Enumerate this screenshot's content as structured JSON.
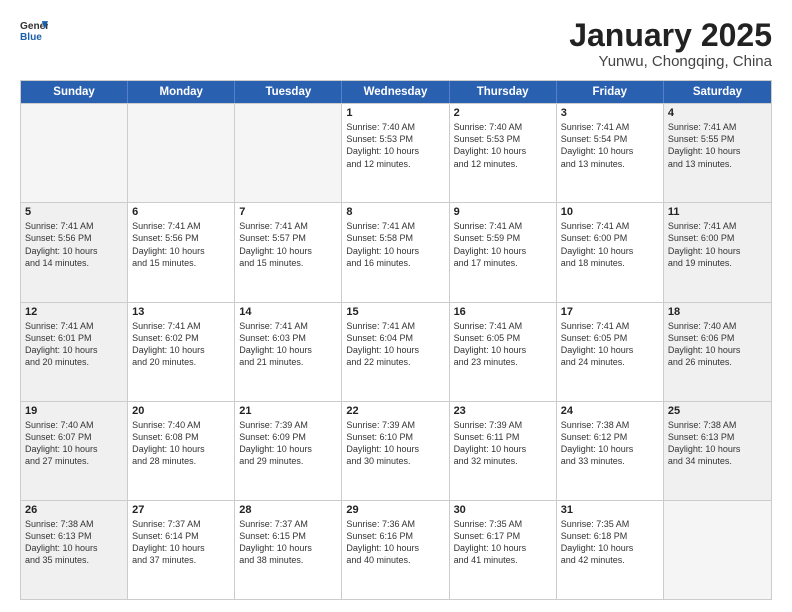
{
  "header": {
    "logo_general": "General",
    "logo_blue": "Blue",
    "month_title": "January 2025",
    "location": "Yunwu, Chongqing, China"
  },
  "days_of_week": [
    "Sunday",
    "Monday",
    "Tuesday",
    "Wednesday",
    "Thursday",
    "Friday",
    "Saturday"
  ],
  "rows": [
    [
      {
        "day": "",
        "info": "",
        "empty": true
      },
      {
        "day": "",
        "info": "",
        "empty": true
      },
      {
        "day": "",
        "info": "",
        "empty": true
      },
      {
        "day": "1",
        "info": "Sunrise: 7:40 AM\nSunset: 5:53 PM\nDaylight: 10 hours\nand 12 minutes."
      },
      {
        "day": "2",
        "info": "Sunrise: 7:40 AM\nSunset: 5:53 PM\nDaylight: 10 hours\nand 12 minutes."
      },
      {
        "day": "3",
        "info": "Sunrise: 7:41 AM\nSunset: 5:54 PM\nDaylight: 10 hours\nand 13 minutes."
      },
      {
        "day": "4",
        "info": "Sunrise: 7:41 AM\nSunset: 5:55 PM\nDaylight: 10 hours\nand 13 minutes."
      }
    ],
    [
      {
        "day": "5",
        "info": "Sunrise: 7:41 AM\nSunset: 5:56 PM\nDaylight: 10 hours\nand 14 minutes."
      },
      {
        "day": "6",
        "info": "Sunrise: 7:41 AM\nSunset: 5:56 PM\nDaylight: 10 hours\nand 15 minutes."
      },
      {
        "day": "7",
        "info": "Sunrise: 7:41 AM\nSunset: 5:57 PM\nDaylight: 10 hours\nand 15 minutes."
      },
      {
        "day": "8",
        "info": "Sunrise: 7:41 AM\nSunset: 5:58 PM\nDaylight: 10 hours\nand 16 minutes."
      },
      {
        "day": "9",
        "info": "Sunrise: 7:41 AM\nSunset: 5:59 PM\nDaylight: 10 hours\nand 17 minutes."
      },
      {
        "day": "10",
        "info": "Sunrise: 7:41 AM\nSunset: 6:00 PM\nDaylight: 10 hours\nand 18 minutes."
      },
      {
        "day": "11",
        "info": "Sunrise: 7:41 AM\nSunset: 6:00 PM\nDaylight: 10 hours\nand 19 minutes."
      }
    ],
    [
      {
        "day": "12",
        "info": "Sunrise: 7:41 AM\nSunset: 6:01 PM\nDaylight: 10 hours\nand 20 minutes."
      },
      {
        "day": "13",
        "info": "Sunrise: 7:41 AM\nSunset: 6:02 PM\nDaylight: 10 hours\nand 20 minutes."
      },
      {
        "day": "14",
        "info": "Sunrise: 7:41 AM\nSunset: 6:03 PM\nDaylight: 10 hours\nand 21 minutes."
      },
      {
        "day": "15",
        "info": "Sunrise: 7:41 AM\nSunset: 6:04 PM\nDaylight: 10 hours\nand 22 minutes."
      },
      {
        "day": "16",
        "info": "Sunrise: 7:41 AM\nSunset: 6:05 PM\nDaylight: 10 hours\nand 23 minutes."
      },
      {
        "day": "17",
        "info": "Sunrise: 7:41 AM\nSunset: 6:05 PM\nDaylight: 10 hours\nand 24 minutes."
      },
      {
        "day": "18",
        "info": "Sunrise: 7:40 AM\nSunset: 6:06 PM\nDaylight: 10 hours\nand 26 minutes."
      }
    ],
    [
      {
        "day": "19",
        "info": "Sunrise: 7:40 AM\nSunset: 6:07 PM\nDaylight: 10 hours\nand 27 minutes."
      },
      {
        "day": "20",
        "info": "Sunrise: 7:40 AM\nSunset: 6:08 PM\nDaylight: 10 hours\nand 28 minutes."
      },
      {
        "day": "21",
        "info": "Sunrise: 7:39 AM\nSunset: 6:09 PM\nDaylight: 10 hours\nand 29 minutes."
      },
      {
        "day": "22",
        "info": "Sunrise: 7:39 AM\nSunset: 6:10 PM\nDaylight: 10 hours\nand 30 minutes."
      },
      {
        "day": "23",
        "info": "Sunrise: 7:39 AM\nSunset: 6:11 PM\nDaylight: 10 hours\nand 32 minutes."
      },
      {
        "day": "24",
        "info": "Sunrise: 7:38 AM\nSunset: 6:12 PM\nDaylight: 10 hours\nand 33 minutes."
      },
      {
        "day": "25",
        "info": "Sunrise: 7:38 AM\nSunset: 6:13 PM\nDaylight: 10 hours\nand 34 minutes."
      }
    ],
    [
      {
        "day": "26",
        "info": "Sunrise: 7:38 AM\nSunset: 6:13 PM\nDaylight: 10 hours\nand 35 minutes."
      },
      {
        "day": "27",
        "info": "Sunrise: 7:37 AM\nSunset: 6:14 PM\nDaylight: 10 hours\nand 37 minutes."
      },
      {
        "day": "28",
        "info": "Sunrise: 7:37 AM\nSunset: 6:15 PM\nDaylight: 10 hours\nand 38 minutes."
      },
      {
        "day": "29",
        "info": "Sunrise: 7:36 AM\nSunset: 6:16 PM\nDaylight: 10 hours\nand 40 minutes."
      },
      {
        "day": "30",
        "info": "Sunrise: 7:35 AM\nSunset: 6:17 PM\nDaylight: 10 hours\nand 41 minutes."
      },
      {
        "day": "31",
        "info": "Sunrise: 7:35 AM\nSunset: 6:18 PM\nDaylight: 10 hours\nand 42 minutes."
      },
      {
        "day": "",
        "info": "",
        "empty": true
      }
    ]
  ]
}
